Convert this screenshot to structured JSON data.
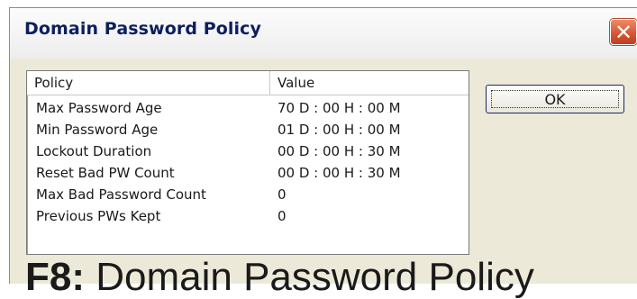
{
  "window": {
    "title": "Domain Password Policy",
    "close_glyph": "✕"
  },
  "list": {
    "columns": [
      "Policy",
      "Value"
    ],
    "rows": [
      {
        "policy": "Max Password Age",
        "value": "70 D : 00 H : 00 M"
      },
      {
        "policy": "Min Password Age",
        "value": "01 D : 00 H : 00 M"
      },
      {
        "policy": "Lockout Duration",
        "value": "00 D : 00 H : 30 M"
      },
      {
        "policy": "Reset Bad PW Count",
        "value": "00 D : 00 H : 30 M"
      },
      {
        "policy": "Max Bad Password Count",
        "value": "0"
      },
      {
        "policy": "Previous PWs Kept",
        "value": "0"
      }
    ]
  },
  "buttons": {
    "ok_label": "OK"
  },
  "caption": {
    "prefix": "F8:",
    "text": " Domain Password Policy"
  },
  "colors": {
    "dialog_bg": "#ece9d8",
    "title_text": "#0c1f5e",
    "close_red": "#d6532f"
  }
}
